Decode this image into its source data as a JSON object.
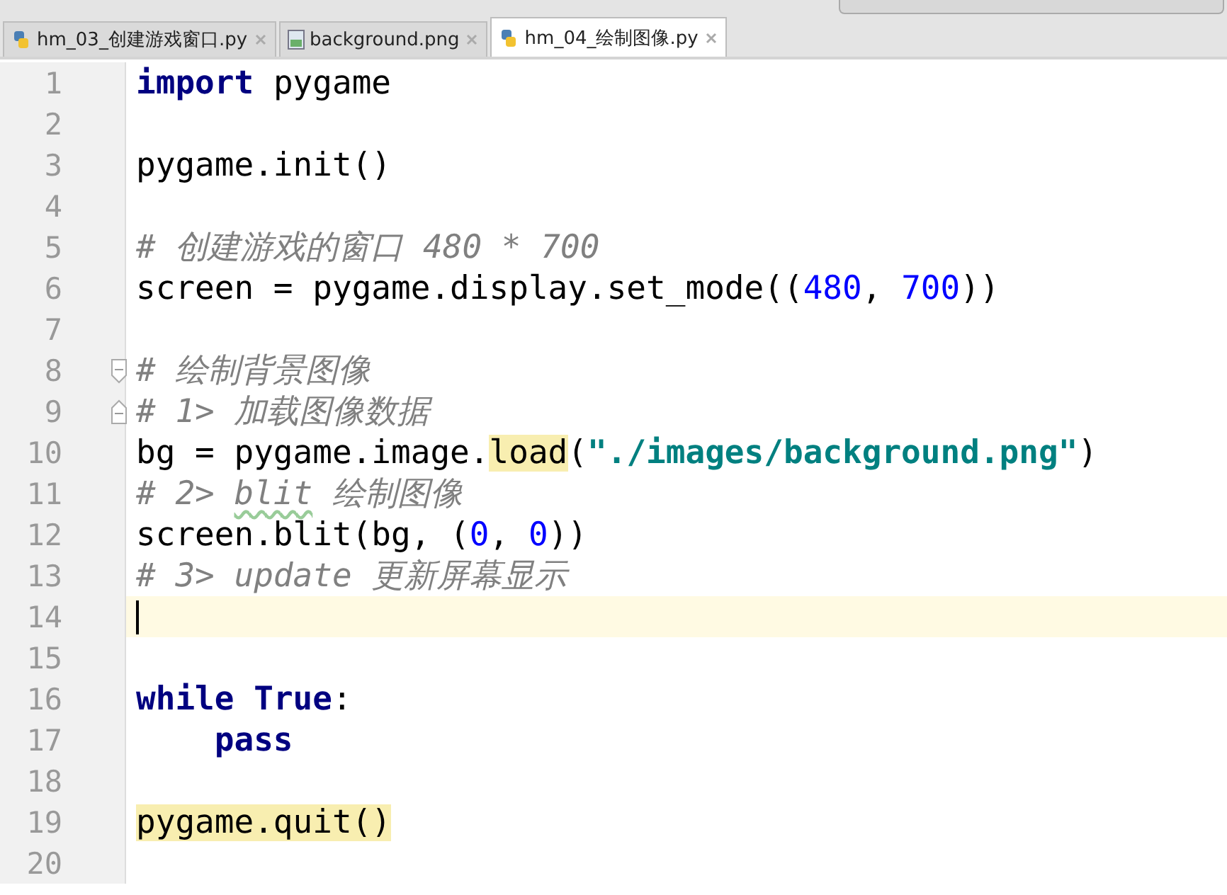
{
  "tabs": [
    {
      "label": "hm_03_创建游戏窗口.py",
      "kind": "python",
      "selected": false
    },
    {
      "label": "background.png",
      "kind": "image",
      "selected": false
    },
    {
      "label": "hm_04_绘制图像.py",
      "kind": "python",
      "selected": true
    }
  ],
  "editor": {
    "lines": [
      {
        "number": "1",
        "tokens": [
          {
            "kind": "kw",
            "text": "import"
          },
          {
            "kind": "plain",
            "text": " pygame"
          }
        ]
      },
      {
        "number": "2"
      },
      {
        "number": "3",
        "tokens": [
          {
            "kind": "plain",
            "text": "pygame.init()"
          }
        ]
      },
      {
        "number": "4"
      },
      {
        "number": "5",
        "tokens": [
          {
            "kind": "comment",
            "text": "# 创建游戏的窗口 480 * 700"
          }
        ]
      },
      {
        "number": "6",
        "tokens": [
          {
            "kind": "plain",
            "text": "screen = pygame.display.set_mode(("
          },
          {
            "kind": "num",
            "text": "480"
          },
          {
            "kind": "plain",
            "text": ", "
          },
          {
            "kind": "num",
            "text": "700"
          },
          {
            "kind": "plain",
            "text": "))"
          }
        ]
      },
      {
        "number": "7"
      },
      {
        "number": "8",
        "fold_start": true,
        "tokens": [
          {
            "kind": "comment",
            "text": "# 绘制背景图像"
          }
        ]
      },
      {
        "number": "9",
        "fold_end": true,
        "tokens": [
          {
            "kind": "comment",
            "text": "# 1> 加载图像数据"
          }
        ]
      },
      {
        "number": "10",
        "tokens": [
          {
            "kind": "plain",
            "text": "bg = pygame.image."
          },
          {
            "kind": "hl",
            "text": "load"
          },
          {
            "kind": "plain",
            "text": "("
          },
          {
            "kind": "str",
            "text": "\"./images/background.png\""
          },
          {
            "kind": "plain",
            "text": ")"
          }
        ]
      },
      {
        "number": "11",
        "tokens": [
          {
            "kind": "comment",
            "text": "# 2> "
          },
          {
            "kind": "typo",
            "text": "blit"
          },
          {
            "kind": "comment",
            "text": " 绘制图像"
          }
        ]
      },
      {
        "number": "12",
        "tokens": [
          {
            "kind": "plain",
            "text": "screen.blit(bg, ("
          },
          {
            "kind": "num",
            "text": "0"
          },
          {
            "kind": "plain",
            "text": ", "
          },
          {
            "kind": "num",
            "text": "0"
          },
          {
            "kind": "plain",
            "text": "))"
          }
        ]
      },
      {
        "number": "13",
        "tokens": [
          {
            "kind": "comment",
            "text": "# 3> update 更新屏幕显示"
          }
        ]
      },
      {
        "number": "14",
        "current": true
      },
      {
        "number": "15"
      },
      {
        "number": "16",
        "tokens": [
          {
            "kind": "kw",
            "text": "while"
          },
          {
            "kind": "kw",
            "text": " True"
          },
          {
            "kind": "plain",
            "text": ":"
          }
        ]
      },
      {
        "number": "17",
        "tokens": [
          {
            "kind": "kw",
            "text": "    pass"
          }
        ]
      },
      {
        "number": "18"
      },
      {
        "number": "19",
        "tokens": [
          {
            "kind": "hl",
            "text": "pygame.quit()"
          }
        ]
      },
      {
        "number": "20"
      }
    ]
  }
}
